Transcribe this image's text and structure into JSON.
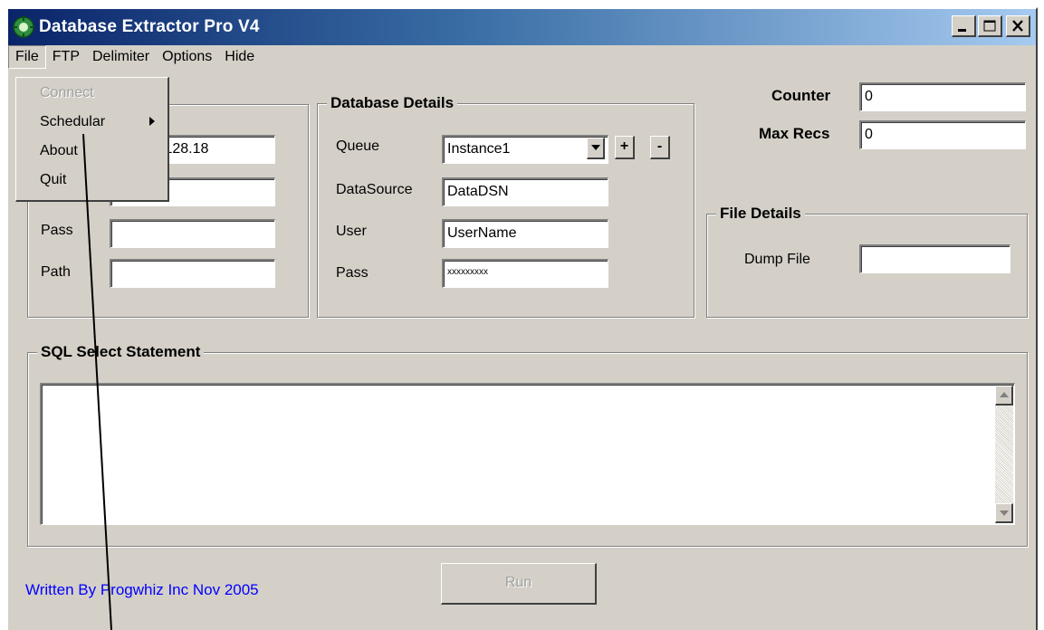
{
  "window": {
    "title": "Database Extractor Pro V4",
    "minimize": "_",
    "maximize": "□",
    "close": "✕"
  },
  "menubar": {
    "items": [
      "File",
      "FTP",
      "Delimiter",
      "Options",
      "Hide"
    ]
  },
  "file_menu": {
    "items": [
      {
        "label": "Connect",
        "enabled": false
      },
      {
        "label": "Schedular",
        "submenu": true
      },
      {
        "label": "About"
      },
      {
        "label": "Quit"
      }
    ]
  },
  "connection_panel": {
    "host_value_partial": ".128.18",
    "pass_label": "Pass",
    "path_label": "Path",
    "pass_value": "",
    "path_value": ""
  },
  "database_details": {
    "title": "Database Details",
    "queue_label": "Queue",
    "queue_value": "Instance1",
    "add_button": "+",
    "remove_button": "-",
    "datasource_label": "DataSource",
    "datasource_value": "DataDSN",
    "user_label": "User",
    "user_value": "UserName",
    "pass_label": "Pass",
    "pass_value": "xxxxxxxxx"
  },
  "counters": {
    "counter_label": "Counter",
    "counter_value": "0",
    "max_recs_label": "Max Recs",
    "max_recs_value": "0"
  },
  "file_details": {
    "title": "File Details",
    "dump_file_label": "Dump File",
    "dump_file_value": ""
  },
  "sql": {
    "title": "SQL Select Statement",
    "statement": ""
  },
  "footer": {
    "credit": "Written By Progwhiz Inc Nov 2005",
    "credit_color": "#0000ff",
    "run_label": "Run"
  }
}
